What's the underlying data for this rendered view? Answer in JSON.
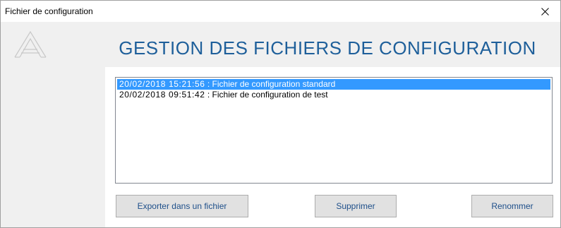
{
  "window": {
    "title": "Fichier de configuration",
    "close_icon": "close-icon"
  },
  "brand": {
    "logo_icon": "logo-a-icon"
  },
  "header": {
    "title": "GESTION DES FICHIERS DE CONFIGURATION",
    "title_color": "#1e5f9a"
  },
  "files": {
    "items": [
      {
        "timestamp": "20/02/2018 15:21:56",
        "description": " : Fichier de configuration standard",
        "selected": true
      },
      {
        "timestamp": "20/02/2018 09:51:42",
        "description": " : Fichier de configuration de test",
        "selected": false
      }
    ],
    "selection_color": "#3399ff"
  },
  "actions": {
    "export_label": "Exporter dans un fichier",
    "delete_label": "Supprimer",
    "rename_label": "Renommer"
  }
}
